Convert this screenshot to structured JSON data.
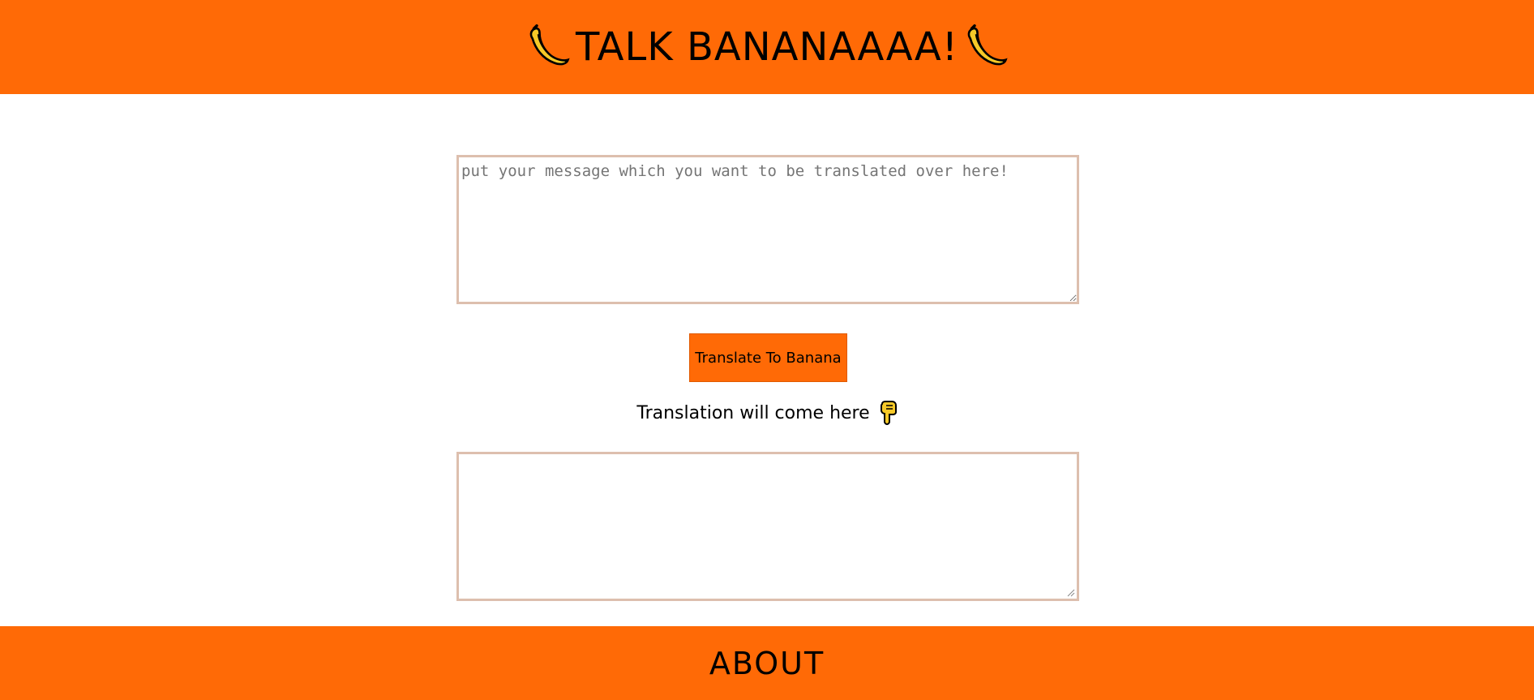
{
  "header": {
    "title": "TALK BANANAAAA!",
    "left_icon": "banana-icon",
    "right_icon": "banana-icon",
    "background": "#ff6a06"
  },
  "input": {
    "placeholder": "put your message which you want to be translated over here!",
    "value": ""
  },
  "translate_button": {
    "label": "Translate To Banana",
    "background": "#ff6a06"
  },
  "caption": {
    "text": "Translation will come here",
    "icon": "pointing-down-icon"
  },
  "output": {
    "value": ""
  },
  "footer": {
    "label": "ABOUT",
    "background": "#ff6a06"
  }
}
